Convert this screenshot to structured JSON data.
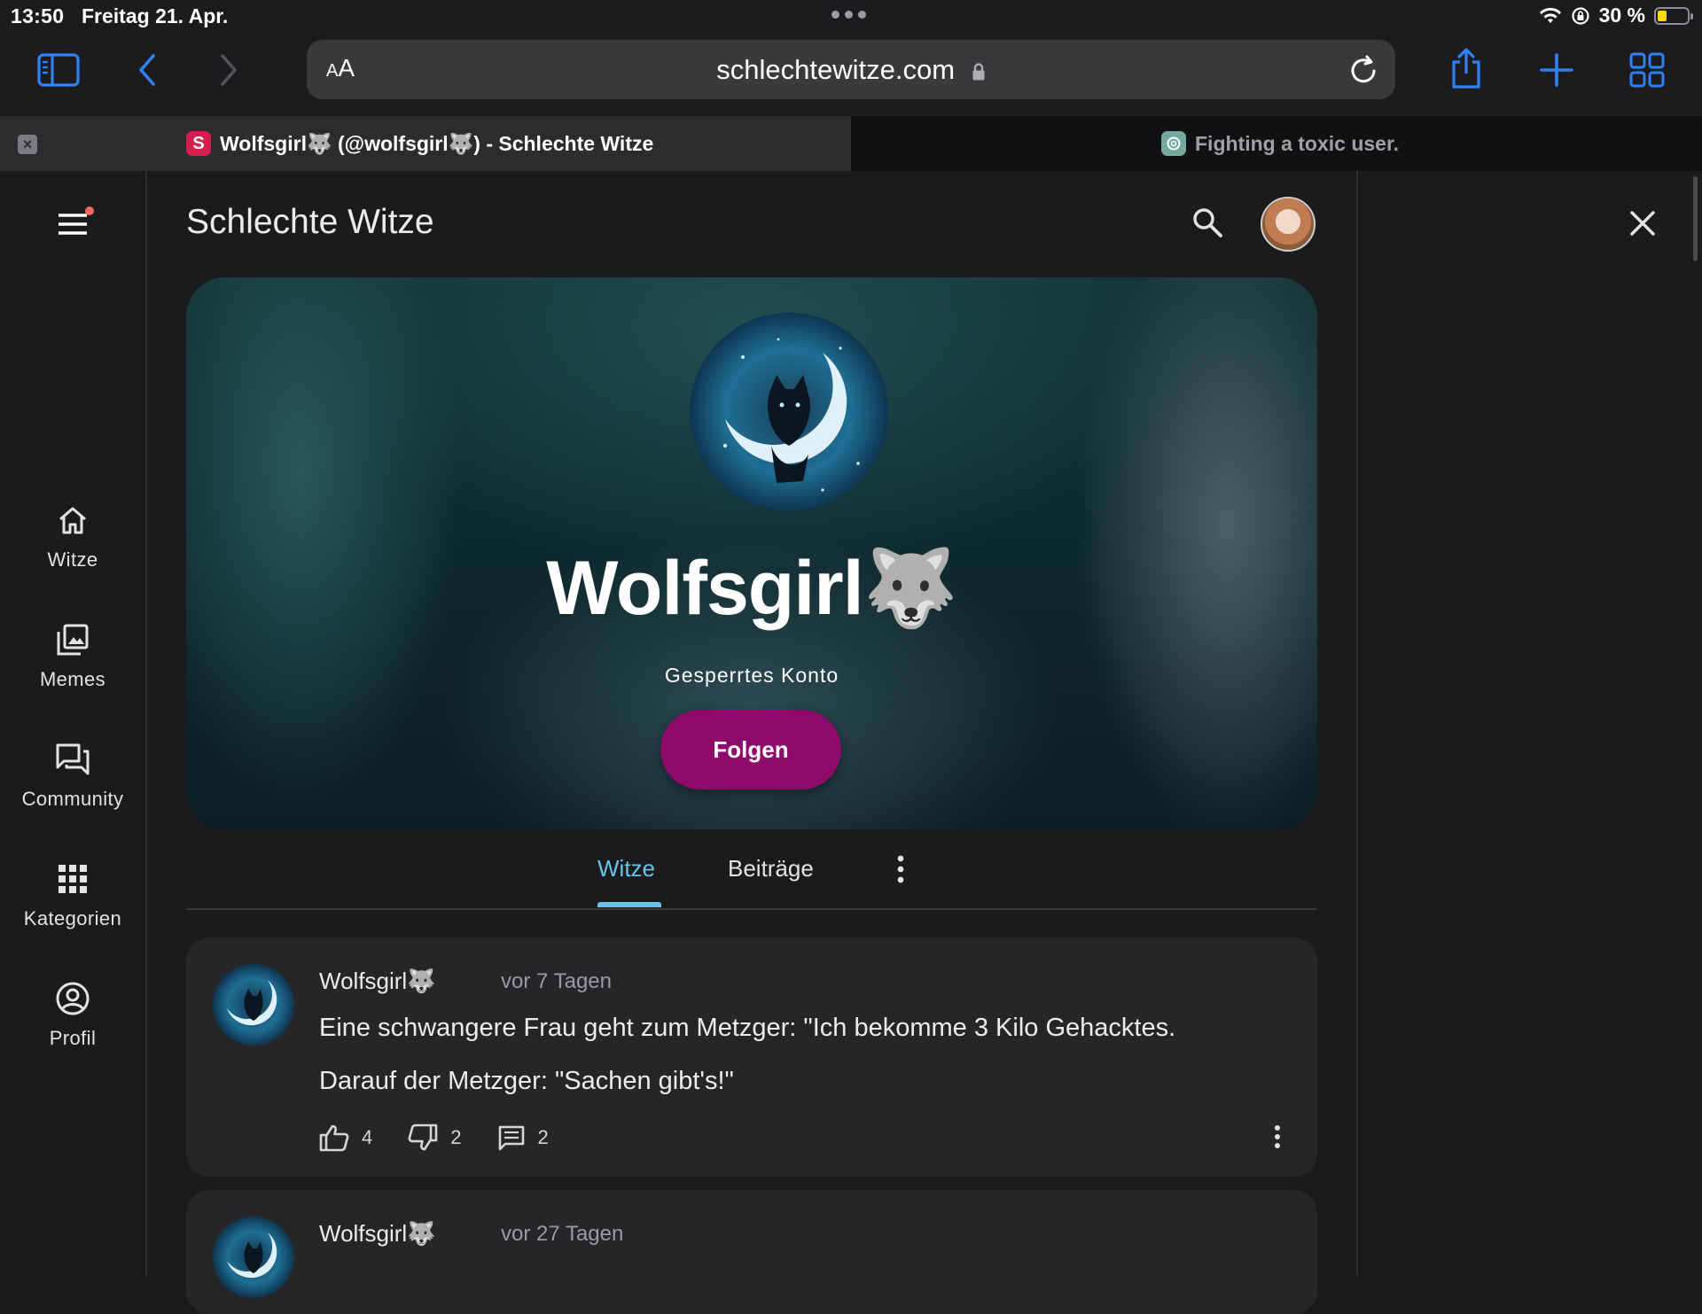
{
  "status_bar": {
    "time": "13:50",
    "date": "Freitag 21. Apr.",
    "battery_percent": "30 %",
    "battery_level": 0.3,
    "battery_color": "#ffd60a"
  },
  "toolbar": {
    "aa_small": "A",
    "aa_large": "A",
    "url": "schlechtewitze.com",
    "accent_color": "#2f81f7"
  },
  "tabs": [
    {
      "title": "Wolfsgirl🐺 (@wolfsgirl🐺) - Schlechte Witze",
      "favicon_letter": "S",
      "active": true
    },
    {
      "title": "Fighting a toxic user.",
      "active": false
    }
  ],
  "sidebar": {
    "items": [
      {
        "label": "Witze",
        "icon": "home-icon"
      },
      {
        "label": "Memes",
        "icon": "image-stack-icon"
      },
      {
        "label": "Community",
        "icon": "forum-icon"
      },
      {
        "label": "Kategorien",
        "icon": "grid-icon"
      },
      {
        "label": "Profil",
        "icon": "account-circle-icon"
      }
    ]
  },
  "header": {
    "site_title": "Schlechte Witze"
  },
  "profile": {
    "name": "Wolfsgirl🐺",
    "status": "Gesperrtes Konto",
    "follow_label": "Folgen",
    "follow_color": "#8e0b6b"
  },
  "profile_tabs": [
    {
      "label": "Witze",
      "active": true
    },
    {
      "label": "Beiträge",
      "active": false
    }
  ],
  "posts": [
    {
      "author": "Wolfsgirl🐺",
      "time": "vor 7 Tagen",
      "lines": [
        "Eine schwangere Frau geht zum Metzger: \"Ich bekomme 3 Kilo Gehacktes.",
        "Darauf der Metzger: \"Sachen gibt's!\""
      ],
      "likes": "4",
      "dislikes": "2",
      "comments": "2"
    },
    {
      "author": "Wolfsgirl🐺",
      "time": "vor 27 Tagen"
    }
  ],
  "colors": {
    "active_tab": "#68c3e8",
    "card_bg": "#262628"
  }
}
